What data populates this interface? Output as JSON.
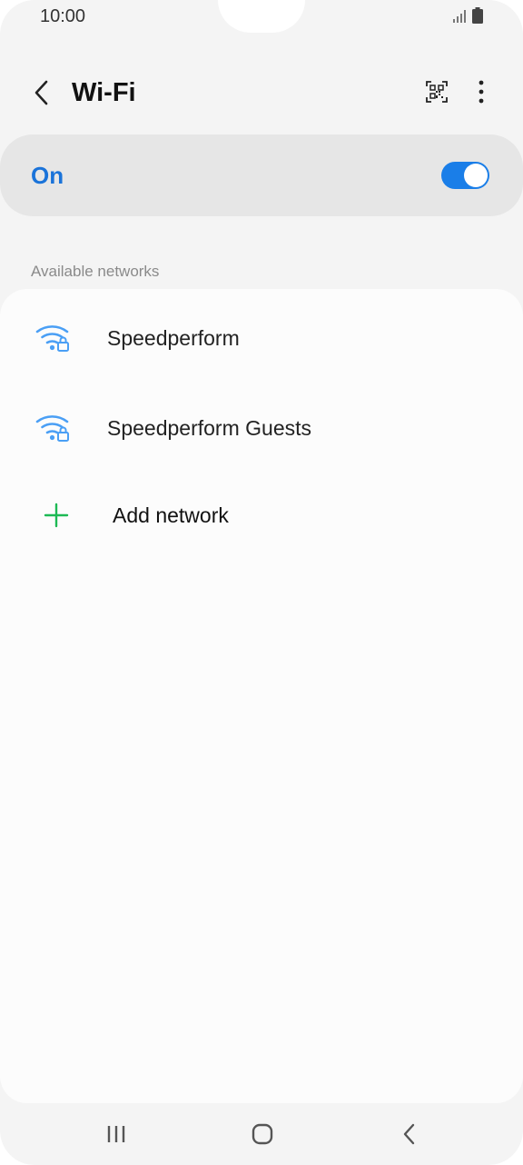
{
  "status_bar": {
    "time": "10:00",
    "icons": [
      "signal-icon",
      "battery-icon"
    ]
  },
  "header": {
    "title": "Wi-Fi",
    "icons": [
      "back-icon",
      "qr-code-icon",
      "more-options-icon"
    ]
  },
  "wifi_toggle": {
    "label": "On",
    "state": "on",
    "accent_color": "#1a7ee8"
  },
  "available_networks": {
    "section_label": "Available networks",
    "networks": [
      {
        "name": "Speedperform",
        "icon": "wifi-locked-icon"
      },
      {
        "name": "Speedperform Guests",
        "icon": "wifi-locked-icon"
      }
    ],
    "add_network": {
      "label": "Add network",
      "icon": "plus-icon",
      "color": "#1db954"
    }
  },
  "nav_bar": {
    "icons": [
      "recent-apps-icon",
      "home-icon",
      "back-nav-icon"
    ]
  }
}
